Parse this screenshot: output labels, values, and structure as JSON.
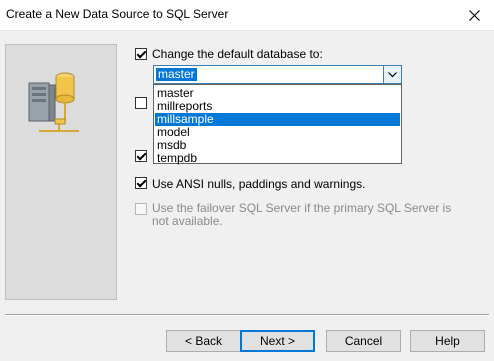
{
  "window": {
    "title": "Create a New Data Source to SQL Server"
  },
  "options": {
    "change_db_label": "Change the default database to:",
    "ansi_label": "Use ANSI nulls, paddings and warnings.",
    "failover_label": "Use the failover SQL Server if the primary SQL Server is not available."
  },
  "combo": {
    "selected_value": "master",
    "options": [
      "master",
      "millreports",
      "millsample",
      "model",
      "msdb",
      "tempdb"
    ],
    "highlighted": "millsample"
  },
  "buttons": {
    "back": "< Back",
    "next": "Next >",
    "cancel": "Cancel",
    "help": "Help"
  },
  "colors": {
    "highlight": "#0078d7"
  }
}
